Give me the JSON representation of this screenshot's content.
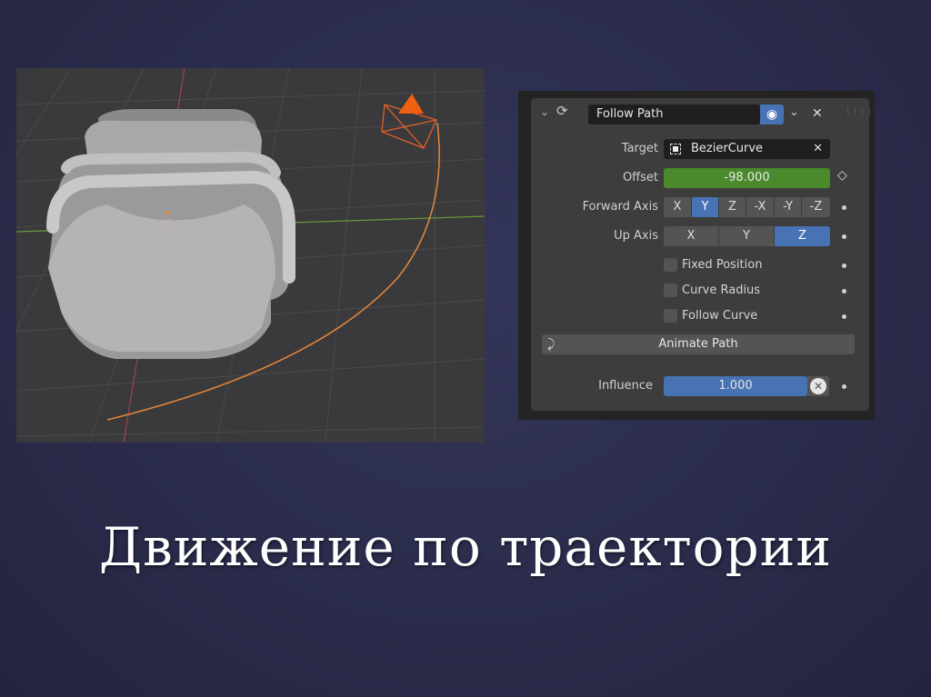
{
  "slide": {
    "title": "Движение по траектории"
  },
  "viewport": {
    "scene": "3d-viewport"
  },
  "constraint": {
    "name": "Follow Path",
    "target_label": "Target",
    "target_value": "BezierCurve",
    "offset_label": "Offset",
    "offset_value": "-98.000",
    "forward_axis_label": "Forward Axis",
    "forward_axis_options": [
      "X",
      "Y",
      "Z",
      "-X",
      "-Y",
      "-Z"
    ],
    "forward_axis_selected": "Y",
    "up_axis_label": "Up Axis",
    "up_axis_options": [
      "X",
      "Y",
      "Z"
    ],
    "up_axis_selected": "Z",
    "checkboxes": [
      {
        "label": "Fixed Position",
        "checked": false
      },
      {
        "label": "Curve Radius",
        "checked": false
      },
      {
        "label": "Follow Curve",
        "checked": false
      }
    ],
    "animate_path_label": "Animate Path",
    "influence_label": "Influence",
    "influence_value": "1.000"
  },
  "colors": {
    "accent_blue": "#4772b3",
    "offset_green": "#4a8a2c",
    "curve_orange": "#e8883a"
  }
}
